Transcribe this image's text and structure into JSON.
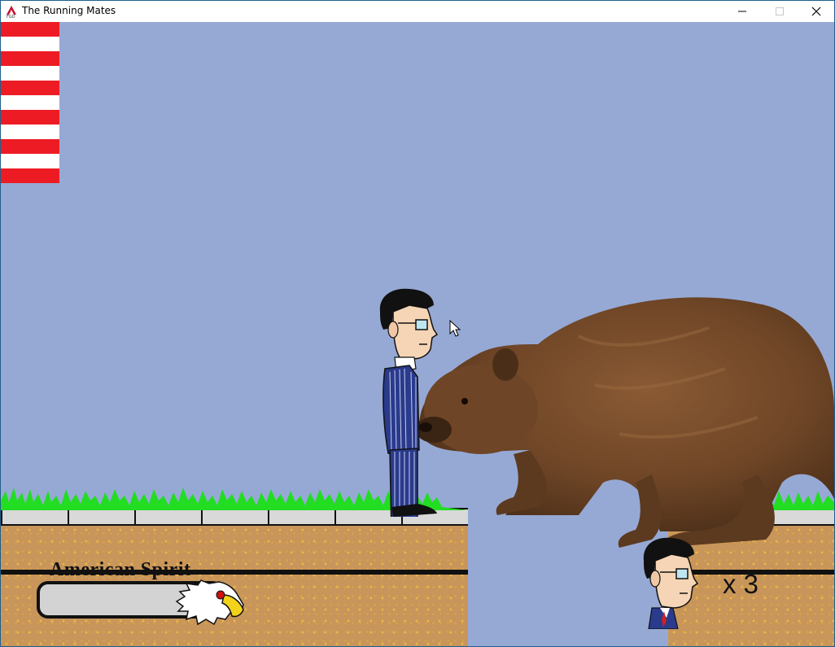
{
  "window": {
    "title": "The Running Mates",
    "controls": [
      "minimize",
      "maximize",
      "close"
    ]
  },
  "hud": {
    "spirit_label": "American Spirit",
    "spirit_level": 0,
    "lives_text": "x 3",
    "lives_count": 3
  },
  "scene": {
    "sky_color": "#96a9d5",
    "player": "suited-candidate-with-glasses",
    "enemy": "brown-bear",
    "decor": [
      "flag-stripes",
      "grass",
      "brick-ledge",
      "dirt-ground"
    ]
  },
  "colors": {
    "flag_red": "#ed1c24",
    "grass": "#22dd22",
    "dirt": "#c8955a"
  }
}
